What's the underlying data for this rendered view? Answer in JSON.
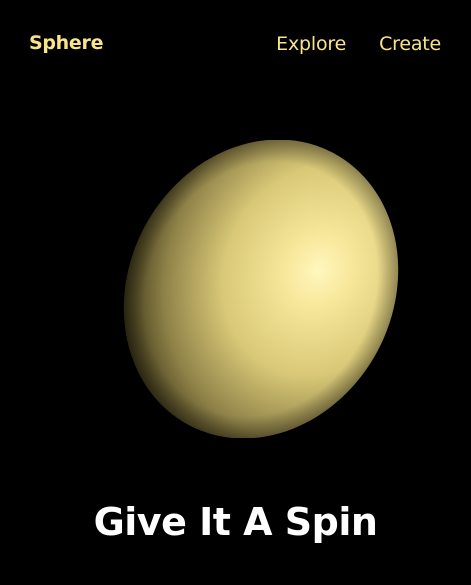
{
  "nav": {
    "logo_label": "Sphere",
    "links": [
      {
        "label": "Explore"
      },
      {
        "label": "Create"
      }
    ]
  },
  "hero": {
    "headline": "Give It A Spin"
  },
  "colors": {
    "background": "#000000",
    "accent": "#f8e48a",
    "sphere_highlight": "#fff6b8",
    "sphere_base": "#d9c878",
    "headline": "#ffffff"
  }
}
